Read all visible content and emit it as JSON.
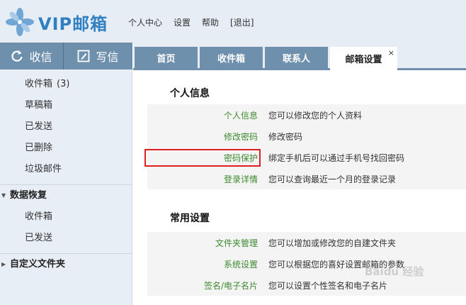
{
  "header": {
    "logo_text": "VIP邮箱",
    "nav": [
      "个人中心",
      "设置",
      "帮助",
      "[退出]"
    ]
  },
  "sidebar": {
    "receive_label": "收信",
    "compose_label": "写信",
    "folders": [
      {
        "label": "收件箱",
        "count": "(3)"
      },
      {
        "label": "草稿箱"
      },
      {
        "label": "已发送"
      },
      {
        "label": "已删除"
      },
      {
        "label": "垃圾邮件"
      }
    ],
    "recovery": {
      "label": "数据恢复",
      "items": [
        "收件箱",
        "已发送"
      ]
    },
    "custom_folders_label": "自定义文件夹"
  },
  "tabs": [
    {
      "label": "首页"
    },
    {
      "label": "收件箱"
    },
    {
      "label": "联系人"
    },
    {
      "label": "邮箱设置",
      "active": true,
      "close": "×"
    }
  ],
  "sections": [
    {
      "title": "个人信息",
      "rows": [
        {
          "label": "个人信息",
          "desc": "您可以修改您的个人资料"
        },
        {
          "label": "修改密码",
          "desc": "修改密码"
        },
        {
          "label": "密码保护",
          "desc": "绑定手机后可以通过手机号找回密码",
          "highlighted": true
        },
        {
          "label": "登录详情",
          "desc": "您可以查询最近一个月的登录记录"
        }
      ]
    },
    {
      "title": "常用设置",
      "rows": [
        {
          "label": "文件夹管理",
          "desc": "您可以增加或修改您的自建文件夹"
        },
        {
          "label": "系统设置",
          "desc": "您可以根据您的喜好设置邮箱的参数"
        },
        {
          "label": "签名/电子名片",
          "desc": "您可以设置个性签名和电子名片"
        }
      ]
    }
  ],
  "watermark": "Baidu 经验",
  "colors": {
    "sidebar_bg": "#e8eef5",
    "button_blue": "#6f90ad",
    "link_green": "#3c8a2e",
    "highlight_red": "#e02020"
  }
}
